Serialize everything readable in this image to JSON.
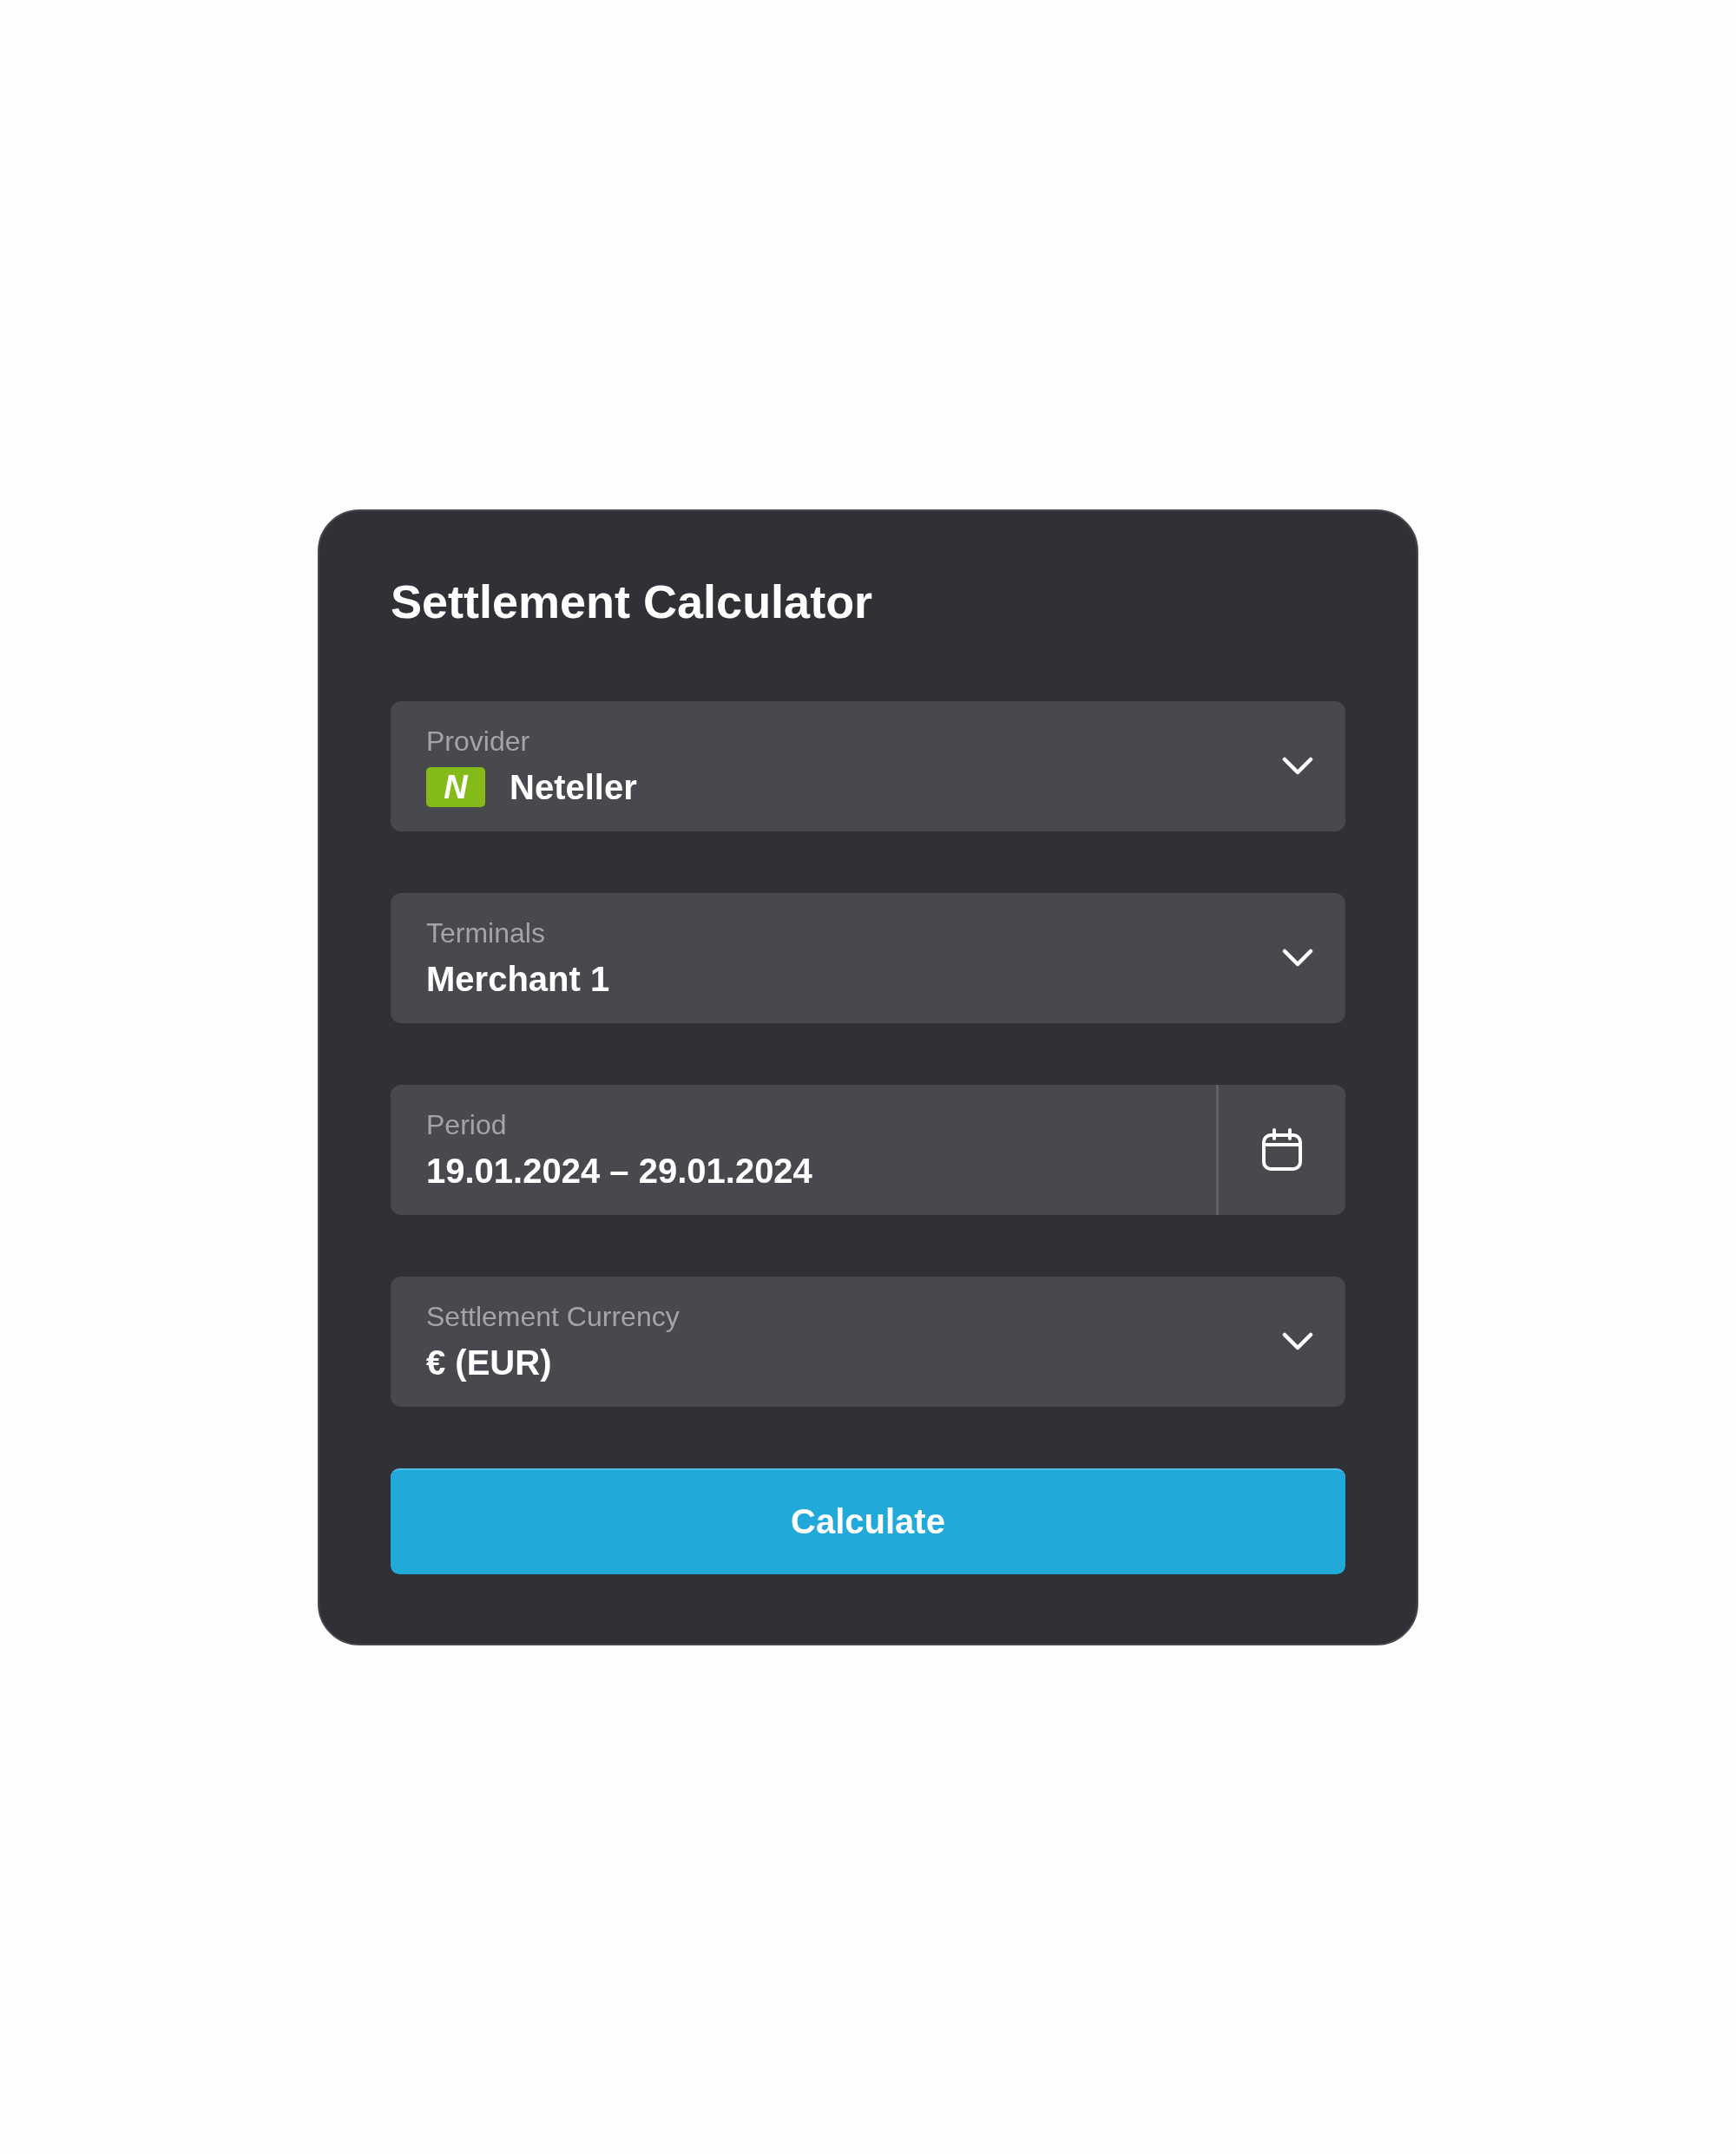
{
  "title": "Settlement Calculator",
  "fields": [
    {
      "kind": "select",
      "label": "Provider",
      "value": "Neteller",
      "logo": "N"
    },
    {
      "kind": "select",
      "label": "Terminals",
      "value": "Merchant 1"
    },
    {
      "kind": "date_range",
      "label": "Period",
      "value": "19.01.2024 – 29.01.2024"
    },
    {
      "kind": "select",
      "label": "Settlement Currency",
      "value": "€ (EUR)"
    }
  ],
  "button": {
    "label": "Calculate"
  }
}
